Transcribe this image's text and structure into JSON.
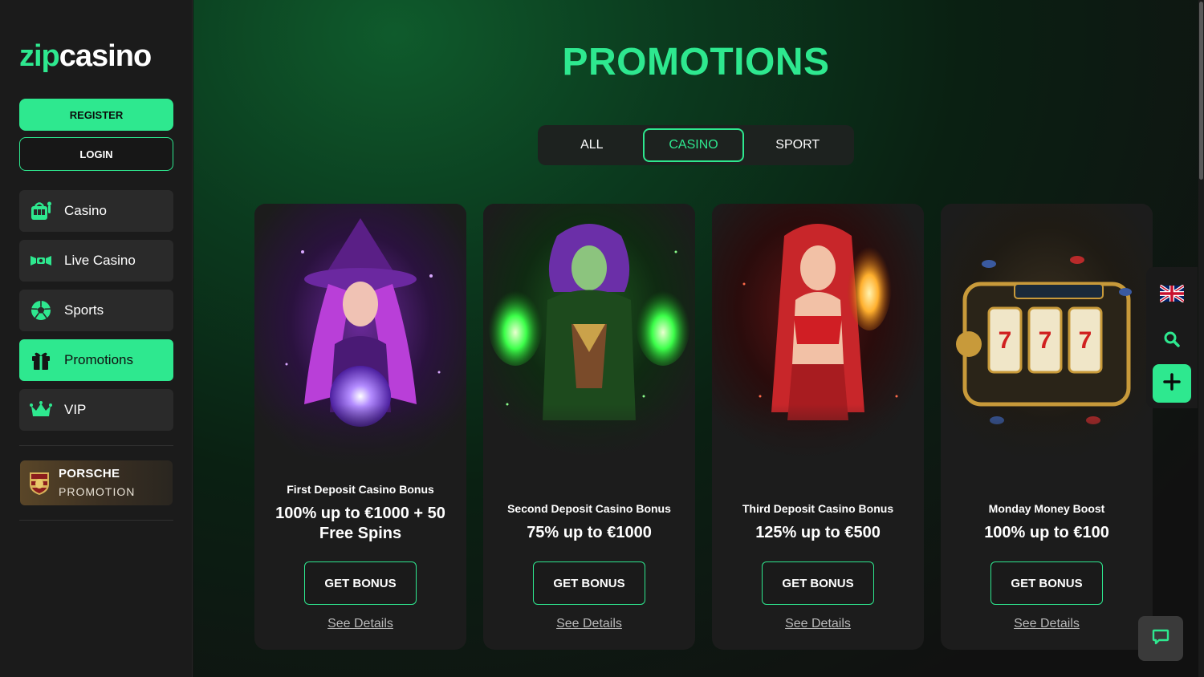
{
  "brand": {
    "name_part1": "zip",
    "name_part2": "casino",
    "accent": "#2ee88f"
  },
  "auth": {
    "register_label": "REGISTER",
    "login_label": "LOGIN"
  },
  "sidebar": {
    "items": [
      {
        "label": "Casino",
        "icon": "slot-machine-icon",
        "active": false
      },
      {
        "label": "Live Casino",
        "icon": "live-casino-icon",
        "active": false
      },
      {
        "label": "Sports",
        "icon": "soccer-ball-icon",
        "active": false
      },
      {
        "label": "Promotions",
        "icon": "gift-icon",
        "active": true
      },
      {
        "label": "VIP",
        "icon": "crown-icon",
        "active": false
      }
    ],
    "porsche": {
      "line1": "PORSCHE",
      "line2": "PROMOTION"
    }
  },
  "page": {
    "title": "PROMOTIONS"
  },
  "tabs": [
    {
      "label": "ALL",
      "active": false
    },
    {
      "label": "CASINO",
      "active": true
    },
    {
      "label": "SPORT",
      "active": false
    }
  ],
  "promotions": [
    {
      "subtitle": "First Deposit Casino Bonus",
      "offer": "100% up to €1000 + 50 Free Spins",
      "button": "GET BONUS",
      "details": "See Details",
      "theme": "purple-witch"
    },
    {
      "subtitle": "Second Deposit Casino Bonus",
      "offer": "75% up to €1000",
      "button": "GET BONUS",
      "details": "See Details",
      "theme": "green-sorceress"
    },
    {
      "subtitle": "Third Deposit Casino Bonus",
      "offer": "125% up to €500",
      "button": "GET BONUS",
      "details": "See Details",
      "theme": "red-fire-mage"
    },
    {
      "subtitle": "Monday Money Boost",
      "offer": "100% up to €100",
      "button": "GET BONUS",
      "details": "See Details",
      "theme": "slot-machine"
    }
  ],
  "rail": {
    "language_icon": "uk-flag-icon",
    "search_icon": "search-icon",
    "plus_icon": "plus-icon"
  },
  "chat": {
    "icon": "chat-bubble-icon"
  }
}
